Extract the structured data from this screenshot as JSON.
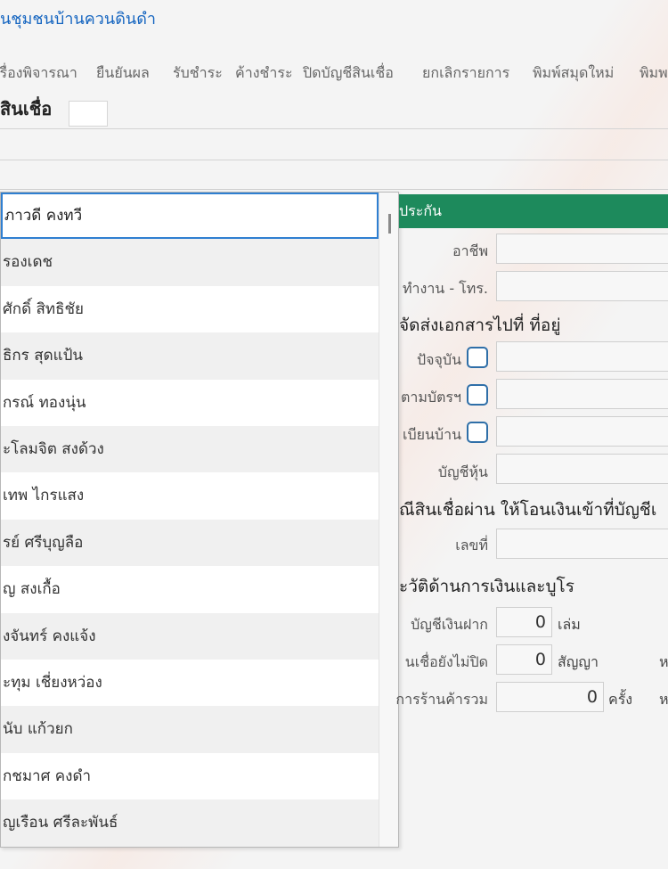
{
  "app": {
    "title": "นชุมชนบ้านควนดินดำ"
  },
  "menu": [
    "เรื่องพิจารณา",
    "ยืนยันผล",
    "รับชำระ",
    "ค้างชำระ",
    "ปิดบัญชีสินเชื่อ",
    "ยกเลิกรายการ",
    "พิมพ์สมุดใหม่",
    "พิมพ"
  ],
  "form": {
    "label": "สินเชื่อ"
  },
  "dropdown": {
    "items": [
      "ภาวดี คงทวี",
      "รองเดช",
      "ศักดิ์ สิทธิชัย",
      "ธิกร สุดแป้น",
      "กรณ์ ทองนุ่น",
      "ะโลมจิต สงด้วง",
      "เทพ ไกรแสง",
      "รย์ ศรีบุญลือ",
      "ญ สงเกื้อ",
      "งจันทร์ คงแจ้ง",
      "ะทุม เชี่ยงหว่อง",
      "นับ แก้วยก",
      "กชมาศ คงดำ",
      "ญเรือน ศรีละพันธ์"
    ],
    "selected_index": 0
  },
  "panel": {
    "header": "ประกัน",
    "occupation_label": "อาชีพ",
    "workplace_label": "ทำงาน - โทร.",
    "send_docs_title": "จัดส่งเอกสารไปที่ ที่อยู่",
    "current_label": "ปัจจุบัน",
    "card_label": "ตามบัตรฯ",
    "house_reg_label": "เบียนบ้าน",
    "share_account_label": "บัญชีหุ้น",
    "transfer_title": "ณีสินเชื่อผ่าน ให้โอนเงินเข้าที่บัญชีเ",
    "number_label": "เลขที่",
    "history_title": "ะวัติด้านการเงินและบูโร",
    "deposit_label": "บัญชีเงินฝาก",
    "deposit_value": "0",
    "deposit_unit": "เล่ม",
    "open_loans_label": "นเชื่อยังไม่ปิด",
    "open_loans_value": "0",
    "open_loans_unit": "สัญญา",
    "store_label": "การร้านค้ารวม",
    "store_value": "0",
    "store_unit": "ครั้ง",
    "trail_1": "ห",
    "trail_2": "ห"
  }
}
